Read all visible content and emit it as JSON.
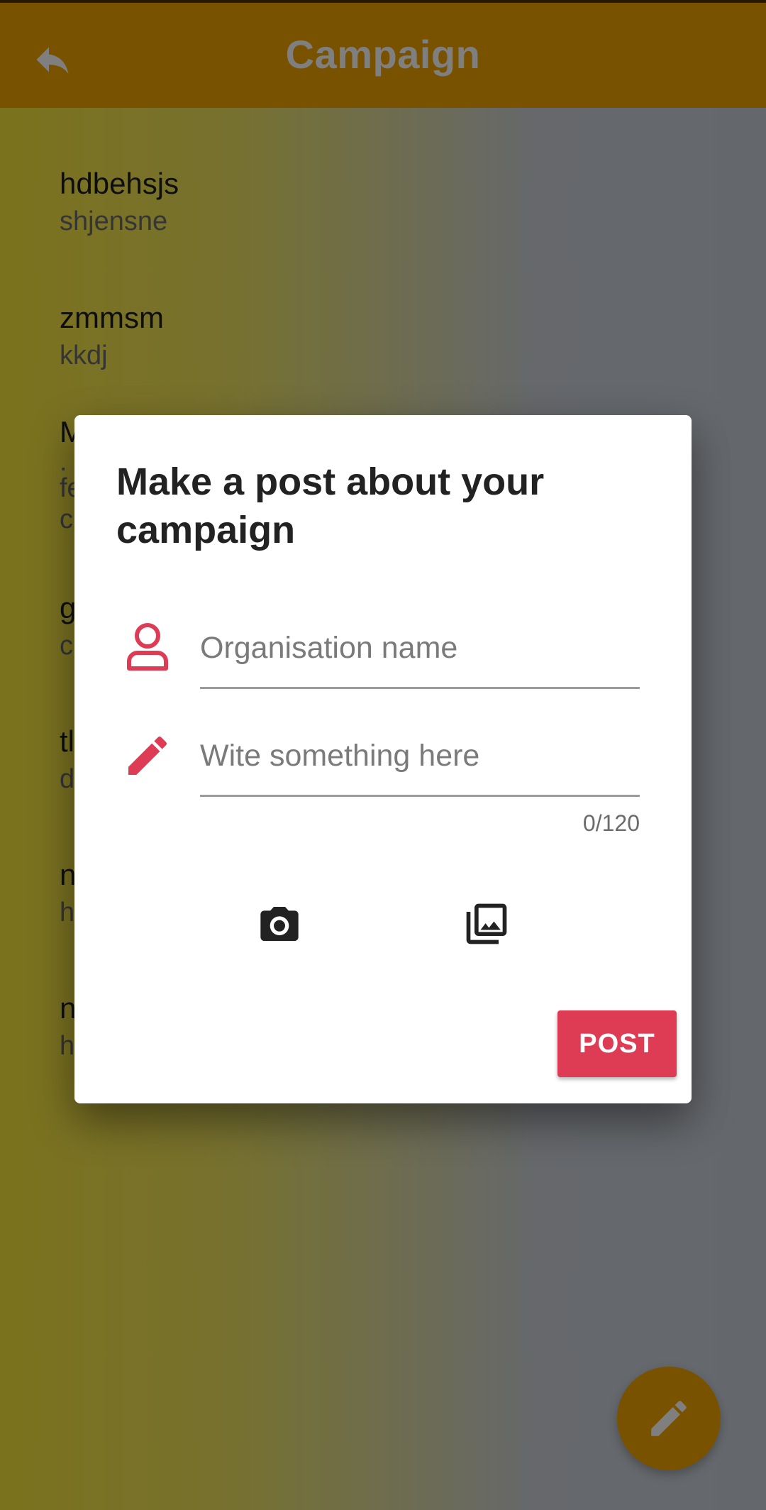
{
  "app_bar": {
    "title": "Campaign",
    "back_icon": "undo-arrow-icon"
  },
  "campaign_list": [
    {
      "title": "hdbehsjs",
      "subtitle": "shjensne"
    },
    {
      "title": "zmmsm",
      "subtitle": "kkdj"
    },
    {
      "title": "M",
      "subtitle": ".",
      "subtitle2": "fe",
      "subtitle3": "c"
    },
    {
      "title": "g",
      "subtitle": "c"
    },
    {
      "title": "tl",
      "subtitle": "d"
    },
    {
      "title": "n",
      "subtitle": "h"
    },
    {
      "title": "n",
      "subtitle": "h"
    }
  ],
  "fab": {
    "icon": "pencil-icon"
  },
  "dialog": {
    "title": "Make a post about your campaign",
    "organisation_field": {
      "placeholder": "Organisation name",
      "value": "",
      "icon": "person-icon"
    },
    "message_field": {
      "placeholder": "Wite something here",
      "value": "",
      "icon": "pencil-icon"
    },
    "counter": "0/120",
    "media_buttons": [
      {
        "icon": "camera-icon"
      },
      {
        "icon": "photo-library-icon"
      }
    ],
    "post_label": "POST"
  },
  "colors": {
    "app_bar": "#f3a500",
    "accent": "#de3c55",
    "fab": "#f3a500"
  }
}
